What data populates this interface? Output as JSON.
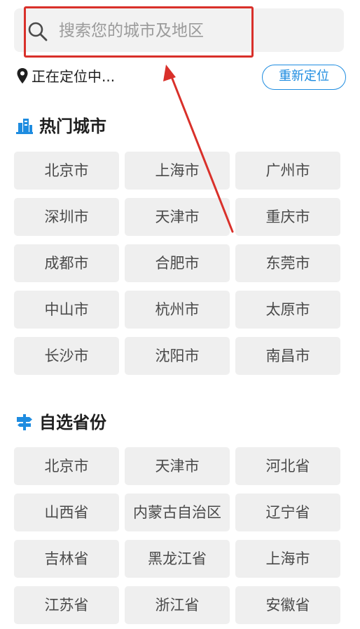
{
  "search": {
    "placeholder": "搜索您的城市及地区"
  },
  "location": {
    "status": "正在定位中...",
    "relocate_label": "重新定位"
  },
  "hot_cities": {
    "title": "热门城市",
    "items": [
      "北京市",
      "上海市",
      "广州市",
      "深圳市",
      "天津市",
      "重庆市",
      "成都市",
      "合肥市",
      "东莞市",
      "中山市",
      "杭州市",
      "太原市",
      "长沙市",
      "沈阳市",
      "南昌市"
    ]
  },
  "provinces": {
    "title": "自选省份",
    "items": [
      "北京市",
      "天津市",
      "河北省",
      "山西省",
      "内蒙古自治区",
      "辽宁省",
      "吉林省",
      "黑龙江省",
      "上海市",
      "江苏省",
      "浙江省",
      "安徽省"
    ]
  },
  "colors": {
    "accent": "#1e8ce0",
    "annotation": "#d9302a",
    "chip_bg": "#efefef"
  },
  "icons": {
    "search": "search-icon",
    "location": "location-pin-icon",
    "hot": "building-icon",
    "province": "signpost-icon"
  }
}
